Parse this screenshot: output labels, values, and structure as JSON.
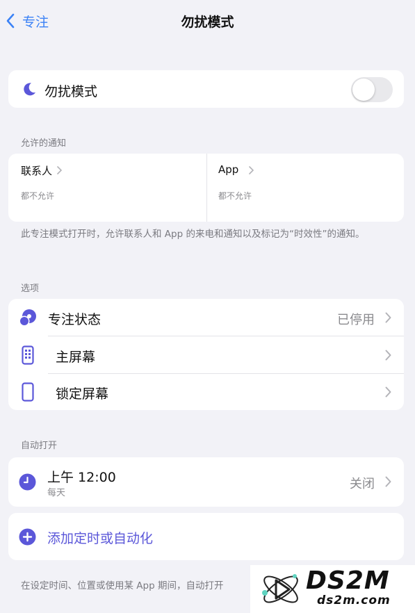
{
  "nav": {
    "back_label": "专注",
    "title": "勿扰模式"
  },
  "toggle_card": {
    "label": "勿扰模式",
    "enabled": false
  },
  "allowed": {
    "section_label": "允许的通知",
    "people": {
      "label": "联系人",
      "value": "都不允许"
    },
    "apps": {
      "label": "App",
      "value": "都不允许"
    },
    "note": "此专注模式打开时，允许联系人和 App 的来电和通知以及标记为“时效性”的通知。"
  },
  "options": {
    "section_label": "选项",
    "items": [
      {
        "label": "专注状态",
        "value": "已停用",
        "icon": "focus-status-icon"
      },
      {
        "label": "主屏幕",
        "value": "",
        "icon": "home-screen-icon"
      },
      {
        "label": "锁定屏幕",
        "value": "",
        "icon": "lock-screen-icon"
      }
    ]
  },
  "auto": {
    "section_label": "自动打开",
    "schedule": {
      "time": "上午 12:00",
      "repeat": "每天",
      "status": "关闭",
      "icon": "clock-icon"
    },
    "add_label": "添加定时或自动化",
    "note": "在设定时间、位置或使用某 App 期间，自动打开"
  },
  "watermark": {
    "name": "DS2M",
    "url": "ds2m.com"
  },
  "colors": {
    "accent": "#5b57d9",
    "link": "#3b82f6",
    "background": "#f2f2f7"
  }
}
